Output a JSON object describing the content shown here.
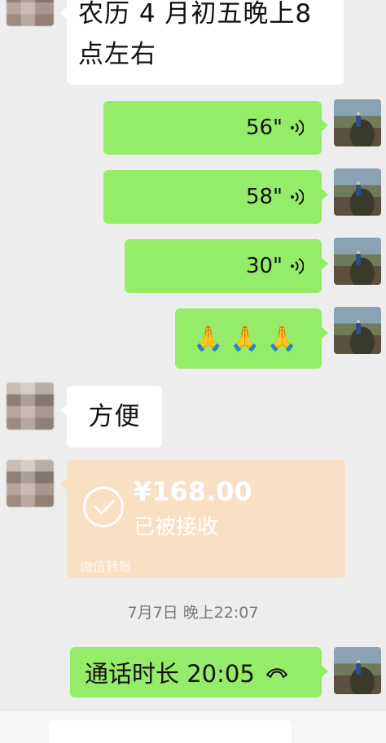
{
  "messages": {
    "lunar_text": "农历 4 月初五晚上8 点左右",
    "voice_1": "56\"",
    "voice_2": "58\"",
    "voice_3": "30\"",
    "emoji": "🙏🙏🙏",
    "reply_text": "方便",
    "transfer": {
      "amount": "¥168.00",
      "status": "已被接收",
      "brand": "微信转账"
    },
    "timestamp": "7月7日 晚上22:07",
    "call_duration": "通话时长 20:05"
  },
  "icons": {
    "voice": "voice-wave-icon",
    "check": "check-circle-icon",
    "call": "phone-hangup-icon"
  },
  "colors": {
    "background": "#ededed",
    "my_bubble": "#95ec69",
    "their_bubble": "#ffffff",
    "transfer_bubble": "#f9dfc4"
  }
}
